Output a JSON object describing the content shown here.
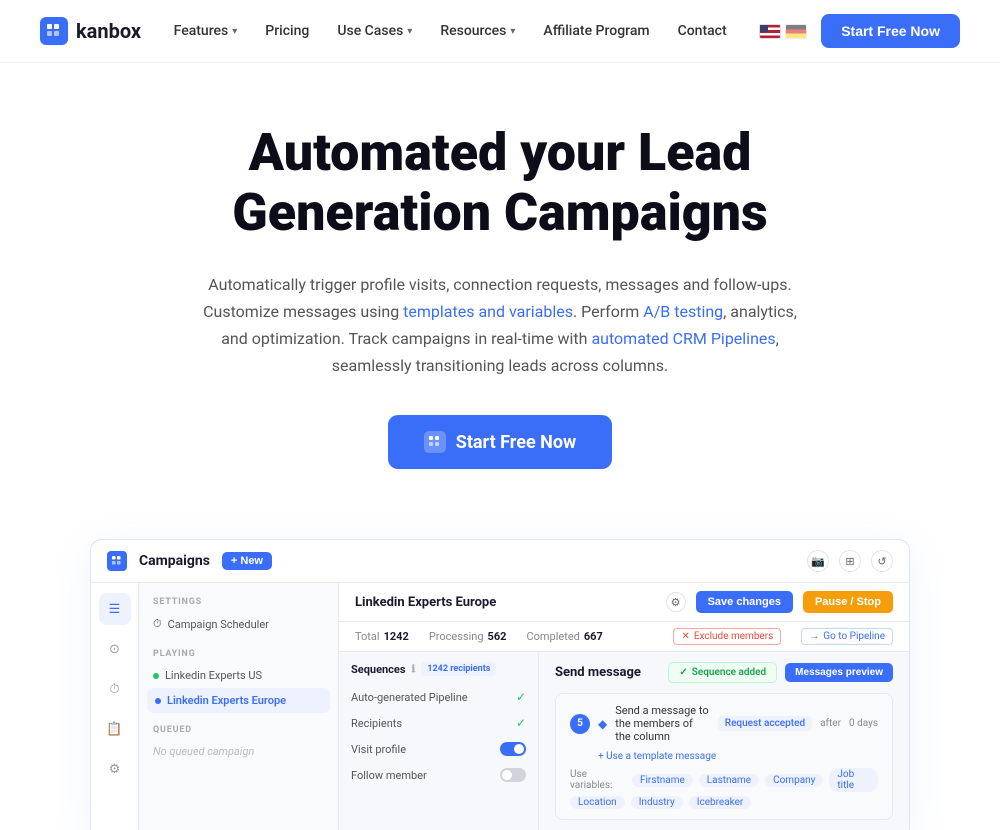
{
  "brand": {
    "name": "kanbox",
    "logo_label": "kk"
  },
  "navbar": {
    "links": [
      {
        "id": "features",
        "label": "Features",
        "has_dropdown": true
      },
      {
        "id": "pricing",
        "label": "Pricing",
        "has_dropdown": false
      },
      {
        "id": "use-cases",
        "label": "Use Cases",
        "has_dropdown": true
      },
      {
        "id": "resources",
        "label": "Resources",
        "has_dropdown": true
      },
      {
        "id": "affiliate",
        "label": "Affiliate Program",
        "has_dropdown": false
      },
      {
        "id": "contact",
        "label": "Contact",
        "has_dropdown": false
      }
    ],
    "cta_label": "Start  Free Now"
  },
  "hero": {
    "title": "Automated your Lead Generation Campaigns",
    "subtitle_plain": "Automatically trigger profile visits, connection requests, messages and follow-ups. Customize messages using ",
    "link1_text": "templates and variables",
    "subtitle_mid": ". Perform ",
    "link2_text": "A/B testing",
    "subtitle_mid2": ", analytics, and optimization. Track campaigns in real-time with ",
    "link3_text": "automated CRM Pipelines",
    "subtitle_end": ", seamlessly transitioning leads across columns.",
    "cta_label": "Start  Free Now",
    "cta_icon": "⬛"
  },
  "app_preview": {
    "topbar": {
      "logo_label": "kk",
      "title": "Campaigns",
      "new_btn": "+ New",
      "icon1": "📷",
      "icon2": "☰",
      "icon3": "↺",
      "campaign_name": "Linkedin Experts Europe",
      "save_btn": "Save changes",
      "pause_btn": "Pause / Stop"
    },
    "stats": {
      "total_label": "Total",
      "total_value": "1242",
      "processing_label": "Processing",
      "processing_value": "562",
      "completed_label": "Completed",
      "completed_value": "667",
      "exclude_label": "Exclude members",
      "pipeline_label": "Go to Pipeline"
    },
    "sidebar_icons": [
      "☰",
      "⊙",
      "⏱",
      "📋",
      "⚙"
    ],
    "left_panel": {
      "settings_label": "SETTINGS",
      "settings_item": "Campaign Scheduler",
      "playing_label": "PLAYING",
      "campaigns": [
        {
          "name": "Linkedin Experts US",
          "active": false
        },
        {
          "name": "Linkedin Experts Europe",
          "active": true
        }
      ],
      "queued_label": "QUEUED",
      "queued_item": "No queued campaign"
    },
    "sequences": {
      "header": "Sequences",
      "info_icon": "ℹ",
      "badge": "1242 recipients",
      "items": [
        {
          "name": "Auto-generated Pipeline",
          "control": "check"
        },
        {
          "name": "Recipients",
          "control": "check"
        },
        {
          "name": "Visit profile",
          "control": "toggle-on"
        },
        {
          "name": "Follow member",
          "control": "toggle-off"
        }
      ]
    },
    "send_message": {
      "title": "Send message",
      "seq_added_label": "Sequence added",
      "msg_preview_label": "Messages preview",
      "card": {
        "num": "5",
        "send_text": "Send a message to the members of the column",
        "tag": "Request accepted",
        "after_label": "after",
        "days": "0 days",
        "template_link": "+ Use a template message",
        "variables_label": "Use variables:",
        "vars": [
          "Firstname",
          "Lastname",
          "Company",
          "Job title"
        ],
        "vars2": [
          "Location",
          "Industry",
          "Icebreaker"
        ]
      }
    }
  }
}
